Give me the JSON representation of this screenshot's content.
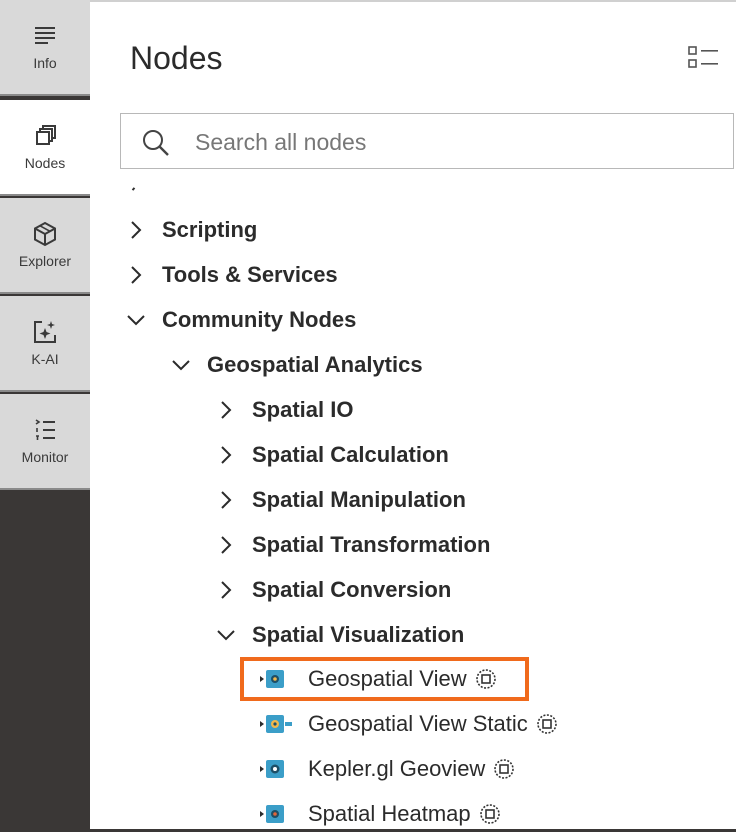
{
  "sidebar": {
    "items": [
      {
        "label": "Info",
        "icon": "info-lines-icon"
      },
      {
        "label": "Nodes",
        "icon": "nodes-cube-icon"
      },
      {
        "label": "Explorer",
        "icon": "explorer-cube-icon"
      },
      {
        "label": "K-AI",
        "icon": "k-ai-sparkle-icon"
      },
      {
        "label": "Monitor",
        "icon": "monitor-list-icon"
      }
    ],
    "active": "Nodes"
  },
  "panel": {
    "title": "Nodes",
    "search_placeholder": "Search all nodes"
  },
  "tree": [
    {
      "label": "Scripting",
      "expanded": false
    },
    {
      "label": "Tools & Services",
      "expanded": false
    },
    {
      "label": "Community Nodes",
      "expanded": true
    },
    {
      "label": "Geospatial Analytics",
      "expanded": true
    },
    {
      "label": "Spatial IO",
      "expanded": false
    },
    {
      "label": "Spatial Calculation",
      "expanded": false
    },
    {
      "label": "Spatial Manipulation",
      "expanded": false
    },
    {
      "label": "Spatial Transformation",
      "expanded": false
    },
    {
      "label": "Spatial Conversion",
      "expanded": false
    },
    {
      "label": "Spatial Visualization",
      "expanded": true
    }
  ],
  "nodes": [
    {
      "label": "Geospatial View",
      "icon": "view-node-icon",
      "highlighted": true
    },
    {
      "label": "Geospatial View Static",
      "icon": "view-static-node-icon",
      "highlighted": false
    },
    {
      "label": "Kepler.gl Geoview",
      "icon": "kepler-node-icon",
      "highlighted": false
    },
    {
      "label": "Spatial Heatmap",
      "icon": "heatmap-node-icon",
      "highlighted": false
    }
  ],
  "colors": {
    "sidebar_bg": "#3a3736",
    "highlight": "#f06a1c",
    "node_teal": "#3b9ec8",
    "node_yellow": "#f2b84b"
  }
}
